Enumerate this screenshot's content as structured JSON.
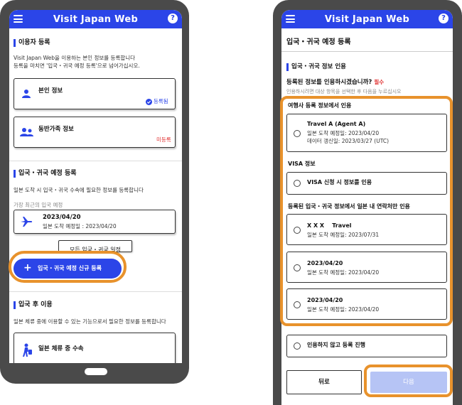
{
  "app_title": "Visit Japan Web",
  "help_label": "?",
  "left": {
    "user_section": {
      "title": "이용자 등록",
      "desc1": "Visit Japan Web을 이용하는 본인 정보를 등록합니다",
      "desc2": "등록을 마치면 '입국・귀국 예정 등록'으로 넘어가십시오.",
      "personal_info": {
        "label": "본인 정보",
        "status": "등록됨"
      },
      "companion_info": {
        "label": "동반가족 정보",
        "status": "미등록"
      }
    },
    "trip_section": {
      "title": "입국・귀국 예정 등록",
      "desc": "일본 도착 시 입국・귀국 수속에 필요한 정보를 등록합니다",
      "recent_label": "가장 최근의 입국 예정",
      "recent_trip": {
        "date": "2023/04/20",
        "arrival": "일본 도착 예정일 : 2023/04/20"
      },
      "all_schedules_button": "모든 입국・귀국 일정",
      "new_button": "입국・귀국 예정 신규 등록"
    },
    "after_section": {
      "title": "입국 후 이용",
      "desc": "일본 체류 중에 이용할 수 있는 기능으로서 필요한 정보를 등록합니다",
      "tax_free": "일본 체류 중 수속"
    }
  },
  "right": {
    "page_title": "입국・귀국 예정 등록",
    "section_title": "입국・귀국 정보 인용",
    "question": "등록된 정보를 인용하시겠습니까?",
    "required": "필수",
    "hint": "인용하시려면 대상 항목을 선택한 후 다음을 누르십시오",
    "group_agency": "여행사 등록 정보에서 인용",
    "agency_option": {
      "name": "Travel A (Agent A)",
      "arrival": "일본 도착 예정일: 2023/04/20",
      "updated": "데이터 갱신일: 2023/03/27 (UTC)"
    },
    "group_visa": "VISA 정보",
    "visa_option": "VISA 신청 시 정보를 인용",
    "group_registered": "등록된 입국・귀국 정보에서 일본 내 연락처만 인용",
    "registered_options": [
      {
        "name": "X X X    Travel",
        "arrival": "일본 도착 예정일: 2023/07/31"
      },
      {
        "name": "2023/04/20",
        "arrival": "일본 도착 예정일: 2023/04/20"
      },
      {
        "name": "2023/04/20",
        "arrival": "일본 도착 예정일: 2023/04/20"
      }
    ],
    "no_quote_option": "인용하지 않고 등록 진행",
    "back_button": "뒤로",
    "next_button": "다음"
  },
  "colors": {
    "brand": "#2b45e8",
    "highlight": "#e8922c",
    "registered": "#2b45e8",
    "unregistered": "#e03030",
    "next_disabled": "#b6c4f5"
  }
}
